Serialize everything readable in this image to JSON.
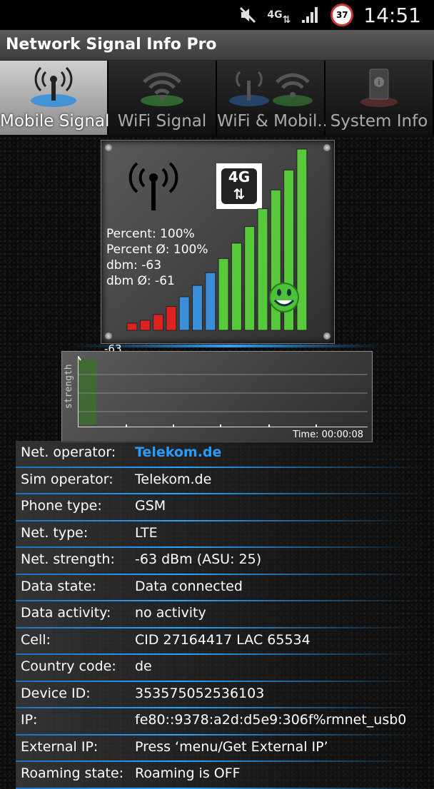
{
  "statusbar": {
    "time": "14:51",
    "network": "4G",
    "battery": "37"
  },
  "app": {
    "title": "Network Signal Info Pro"
  },
  "tabs": [
    {
      "label": "Mobile Signal",
      "active": true
    },
    {
      "label": "WiFi Signal"
    },
    {
      "label": "WiFi & Mobil.."
    },
    {
      "label": "System Info"
    }
  ],
  "signal": {
    "percent": "Percent: 100%",
    "percent_avg": "Percent Ø: 100%",
    "dbm": "dbm: -63",
    "dbm_avg": "dbm Ø: -61",
    "badge": "4G",
    "level": 1.0
  },
  "graph": {
    "value_label": "-63",
    "ylabel": "strength",
    "time": "Time: 00:00:08"
  },
  "info": [
    {
      "key": "Net. operator:",
      "value": "Telekom.de"
    },
    {
      "key": "Sim operator:",
      "value": "Telekom.de"
    },
    {
      "key": "Phone type:",
      "value": "GSM"
    },
    {
      "key": "Net. type:",
      "value": "LTE"
    },
    {
      "key": "Net. strength:",
      "value": "-63 dBm (ASU: 25)"
    },
    {
      "key": "Data state:",
      "value": "Data connected"
    },
    {
      "key": "Data activity:",
      "value": "no activity"
    },
    {
      "key": "Cell:",
      "value": "CID 27164417 LAC 65534"
    },
    {
      "key": "Country code:",
      "value": "de"
    },
    {
      "key": "Device ID:",
      "value": "353575052536103"
    },
    {
      "key": "IP:",
      "value": "fe80::9378:a2d:d5e9:306f%rmnet_usb0"
    },
    {
      "key": "External IP:",
      "value": "Press ‘menu/Get External IP’"
    },
    {
      "key": "Roaming state:",
      "value": "Roaming is OFF"
    }
  ],
  "colors": {
    "accent": "#2b9bff",
    "bar_green": "#58c93a",
    "bar_red": "#d22"
  }
}
